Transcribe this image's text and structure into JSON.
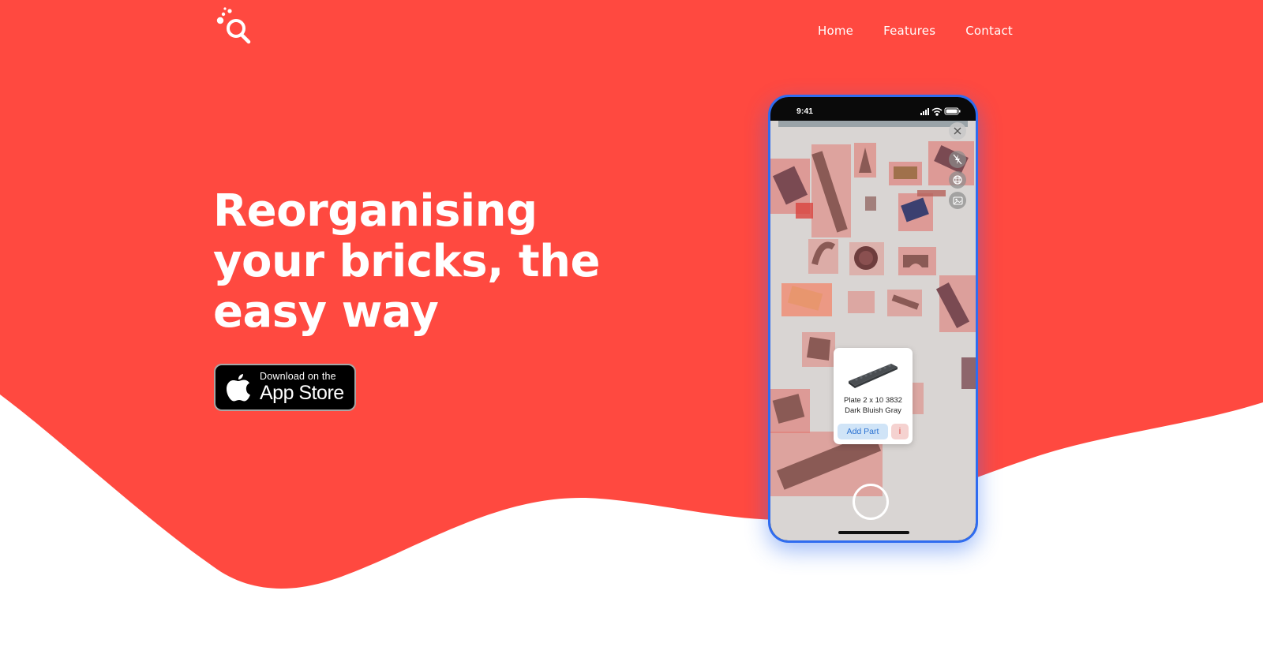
{
  "colors": {
    "brand_red": "#ff4940",
    "phone_border": "#2f6cf0",
    "background": "#ffffff"
  },
  "logo": {
    "icon": "bubbles-magnifier-logo-icon"
  },
  "nav": {
    "links": [
      "Home",
      "Features",
      "Contact"
    ]
  },
  "hero": {
    "headline": "Reorganising your bricks, the easy way",
    "store_button": {
      "small": "Download on the",
      "big": "App Store",
      "icon": "apple-logo-icon"
    }
  },
  "phone": {
    "time": "9:41",
    "status_icons": [
      "signal-icon",
      "wifi-icon",
      "battery-icon"
    ],
    "controls": [
      "close-icon",
      "flash-off-icon",
      "aperture-icon",
      "gallery-icon"
    ],
    "part_card": {
      "name_line1": "Plate 2 x 10 3832",
      "name_line2": "Dark Bluish Gray",
      "add_label": "Add Part",
      "info_label": "i"
    }
  }
}
